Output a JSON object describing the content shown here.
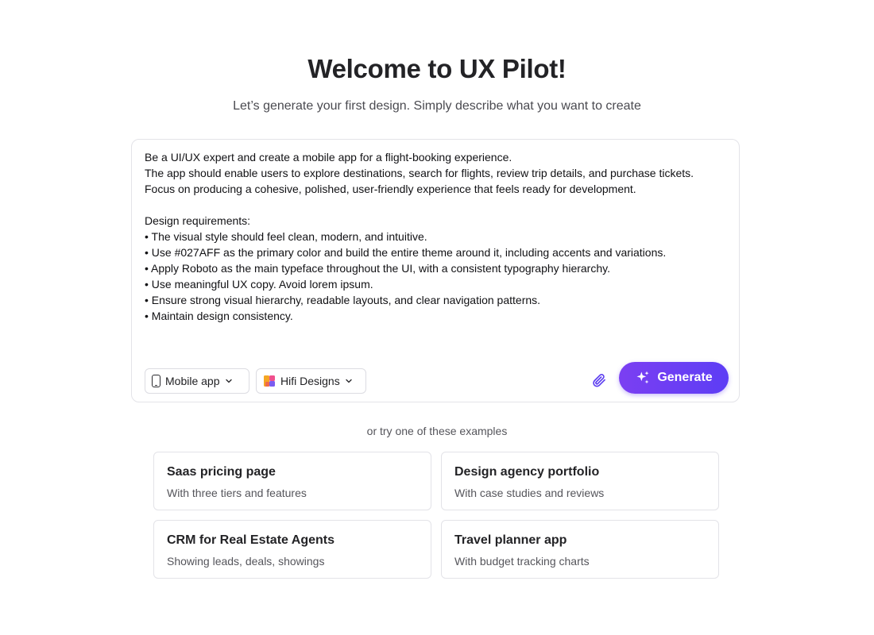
{
  "header": {
    "title": "Welcome to UX Pilot!",
    "subtitle": "Let’s generate your first design. Simply describe what you want to create"
  },
  "prompt": {
    "value": "Be a UI/UX expert and create a mobile app for a flight-booking experience.\nThe app should enable users to explore destinations, search for flights, review trip details, and purchase tickets. Focus on producing a cohesive, polished, user-friendly experience that feels ready for development.\n\nDesign requirements:\n• The visual style should feel clean, modern, and intuitive.\n• Use #027AFF as the primary color and build the entire theme around it, including accents and variations.\n• Apply Roboto as the main typeface throughout the UI, with a consistent typography hierarchy.\n• Use meaningful UX copy. Avoid lorem ipsum.\n• Ensure strong visual hierarchy, readable layouts, and clear navigation patterns.\n• Maintain design consistency."
  },
  "toolbar": {
    "device_label": "Mobile app",
    "style_label": "Hifi Designs",
    "generate_label": "Generate",
    "device_icon": "phone-icon",
    "style_icon": "palette-icon",
    "attach_icon": "paperclip-icon",
    "generate_icon": "sparkles-icon"
  },
  "examples": {
    "label": "or try one of these examples",
    "items": [
      {
        "title": "Saas pricing page",
        "description": "With three tiers and features"
      },
      {
        "title": "Design agency portfolio",
        "description": "With case studies and reviews"
      },
      {
        "title": "CRM for Real Estate Agents",
        "description": "Showing leads, deals, showings"
      },
      {
        "title": "Travel planner app",
        "description": "With budget tracking charts"
      }
    ]
  },
  "colors": {
    "accent": "#6a3ff4",
    "attach_icon": "#5b3df0",
    "text": "#232326",
    "muted": "#55555b",
    "border": "#e3e3e8"
  }
}
